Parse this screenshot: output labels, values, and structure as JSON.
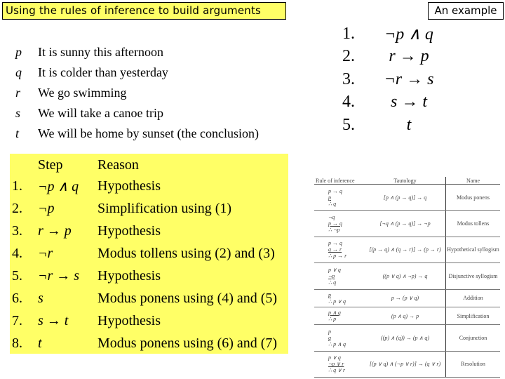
{
  "header": {
    "title": "Using the rules of inference to build arguments",
    "example_label": "An example"
  },
  "variables": [
    {
      "symbol": "p",
      "meaning": "It is sunny this afternoon"
    },
    {
      "symbol": "q",
      "meaning": "It is colder than yesterday"
    },
    {
      "symbol": "r",
      "meaning": "We go swimming"
    },
    {
      "symbol": "s",
      "meaning": "We will take a canoe trip"
    },
    {
      "symbol": "t",
      "meaning": "We will be home by sunset (the conclusion)"
    }
  ],
  "premises": [
    {
      "num": "1.",
      "expr": "¬p ∧ q"
    },
    {
      "num": "2.",
      "expr": "r → p"
    },
    {
      "num": "3.",
      "expr": "¬r → s"
    },
    {
      "num": "4.",
      "expr": "s → t"
    },
    {
      "num": "5.",
      "expr": "t"
    }
  ],
  "steps": {
    "headers": {
      "step": "Step",
      "reason": "Reason"
    },
    "rows": [
      {
        "num": "1.",
        "step": "¬p ∧ q",
        "reason": "Hypothesis"
      },
      {
        "num": "2.",
        "step": "¬p",
        "reason": "Simplification using (1)"
      },
      {
        "num": "3.",
        "step": "r → p",
        "reason": "Hypothesis"
      },
      {
        "num": "4.",
        "step": "¬r",
        "reason": "Modus tollens using (2) and (3)"
      },
      {
        "num": "5.",
        "step": "¬r → s",
        "reason": "Hypothesis"
      },
      {
        "num": "6.",
        "step": "s",
        "reason": "Modus ponens using (4) and (5)"
      },
      {
        "num": "7.",
        "step": "s → t",
        "reason": "Hypothesis"
      },
      {
        "num": "8.",
        "step": "t",
        "reason": "Modus ponens using (6) and (7)"
      }
    ]
  },
  "rules_table": {
    "headers": {
      "rule": "Rule of inference",
      "tautology": "Tautology",
      "name": "Name"
    },
    "rows": [
      {
        "lines": [
          "p → q",
          "p",
          "∴ q"
        ],
        "tautology": "[p ∧ (p → q)] → q",
        "name": "Modus ponens"
      },
      {
        "lines": [
          "¬q",
          "p → q",
          "∴ ¬p"
        ],
        "tautology": "[¬q ∧ (p → q)] → ¬p",
        "name": "Modus tollens"
      },
      {
        "lines": [
          "p → q",
          "q → r",
          "∴ p → r"
        ],
        "tautology": "[(p → q) ∧ (q → r)] → (p → r)",
        "name": "Hypothetical syllogism"
      },
      {
        "lines": [
          "p ∨ q",
          "¬p",
          "∴ q"
        ],
        "tautology": "((p ∨ q) ∧ ¬p) → q",
        "name": "Disjunctive syllogism"
      },
      {
        "lines": [
          "p",
          "∴ p ∨ q"
        ],
        "tautology": "p → (p ∨ q)",
        "name": "Addition"
      },
      {
        "lines": [
          "p ∧ q",
          "∴ p"
        ],
        "tautology": "(p ∧ q) → p",
        "name": "Simplification"
      },
      {
        "lines": [
          "p",
          "q",
          "∴ p ∧ q"
        ],
        "tautology": "((p) ∧ (q)) → (p ∧ q)",
        "name": "Conjunction"
      },
      {
        "lines": [
          "p ∨ q",
          "¬p ∨ r",
          "∴ q ∨ r"
        ],
        "tautology": "[(p ∨ q) ∧ (¬p ∨ r)] → (q ∨ r)",
        "name": "Resolution"
      }
    ]
  },
  "colors": {
    "highlight": "#ffff66"
  }
}
